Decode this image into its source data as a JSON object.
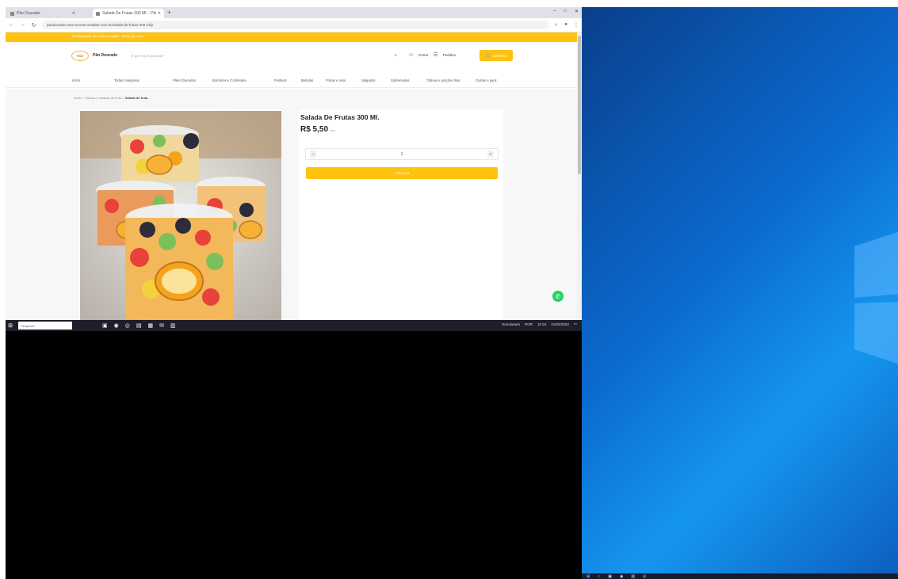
{
  "browser": {
    "tabs": [
      {
        "label": "Pão Dourado"
      },
      {
        "label": "Salada De Frutas 300 Ml. - Pão"
      }
    ],
    "new_tab_glyph": "+",
    "url": "paodourado.vtexcommercestable.com.br/salada-de-frutas-300-ml/p"
  },
  "site": {
    "promo_text": "Entregamos em toda a região · Peça já o seu",
    "logo_text": "PÃO",
    "brand_name": "Pão Dourado",
    "search_placeholder": "O que você procura?",
    "account": {
      "login_label": "Entrar",
      "orders_label": "Pedidos"
    },
    "cart_label": "Carrinho",
    "menu": [
      "Início",
      "Todas categorias",
      "Pães Dourados",
      "Bombons e Confeitaria",
      "Festivos",
      "Bebidas",
      "Frutas e ovos",
      "Salgados",
      "Sobremesas",
      "Tábuas e porções frias",
      "Cestas e pack"
    ],
    "breadcrumb": {
      "path": "Início > Tábuas e saladas de fruta > ",
      "current": "Salada de fruta"
    }
  },
  "product": {
    "title": "Salada De Frutas 300 Ml.",
    "price": "R$ 5,50",
    "unit": "/un",
    "quantity": "1",
    "minus_label": "–",
    "plus_label": "+",
    "add_to_cart_label": "Adicionar"
  },
  "taskbar": {
    "search_placeholder": "Pesquisar",
    "tray_weather": "Ensolarado",
    "tray_lang": "POR",
    "tray_time": "10:24",
    "tray_date": "21/03/2023"
  },
  "colors": {
    "accent": "#ffc20e",
    "whatsapp": "#25d366"
  }
}
